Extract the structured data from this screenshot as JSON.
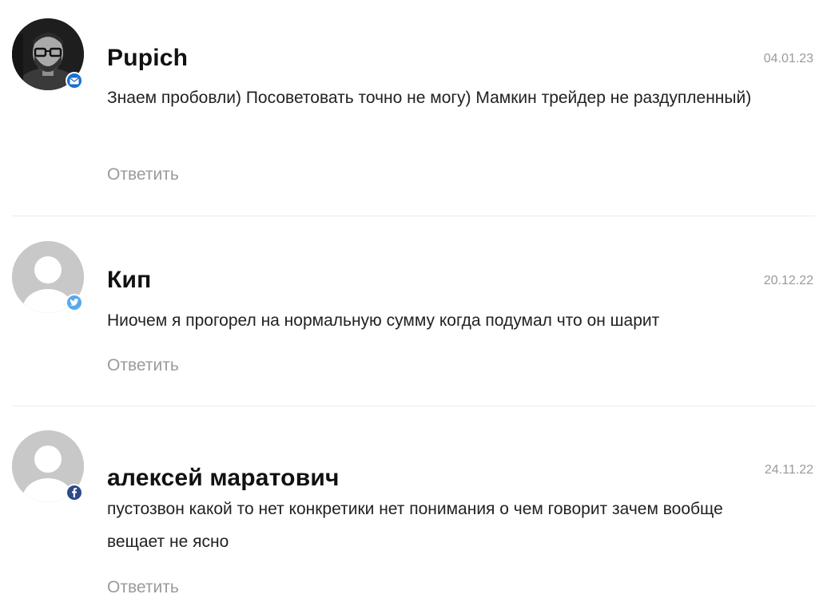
{
  "comments": [
    {
      "author": "Pupich",
      "date": "04.01.23",
      "text": "Знаем пробовли) Посоветовать точно не могу) Мамкин трейдер не раздупленный)",
      "reply_label": "Ответить",
      "avatar": "photo-avatar",
      "network_icon": "email-icon",
      "network_color": "#1b6fd0"
    },
    {
      "author": "Кип",
      "date": "20.12.22",
      "text": "Ниочем я прогорел на нормальную сумму когда подумал что он шарит",
      "reply_label": "Ответить",
      "avatar": "default-avatar",
      "network_icon": "twitter-icon",
      "network_color": "#57a9ec"
    },
    {
      "author": "алексей маратович",
      "date": "24.11.22",
      "text": "пустозвон какой то нет конкретики нет понимания о чем говорит зачем вообще вещает не ясно",
      "reply_label": "Ответить",
      "avatar": "default-avatar",
      "network_icon": "facebook-icon",
      "network_color": "#2c4a8c"
    }
  ]
}
